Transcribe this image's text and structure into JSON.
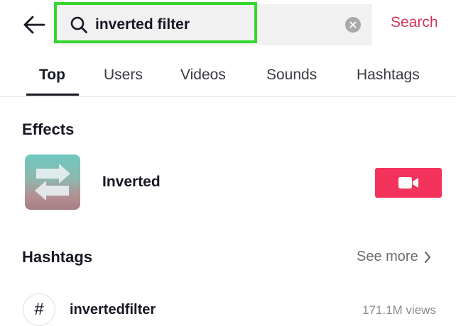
{
  "search": {
    "value": "inverted filter",
    "button_label": "Search"
  },
  "tabs": [
    {
      "label": "Top",
      "active": true
    },
    {
      "label": "Users"
    },
    {
      "label": "Videos"
    },
    {
      "label": "Sounds"
    },
    {
      "label": "Hashtags"
    }
  ],
  "effects": {
    "title": "Effects",
    "items": [
      {
        "name": "Inverted",
        "icon": "video-camera-icon"
      }
    ]
  },
  "hashtags": {
    "title": "Hashtags",
    "see_more_label": "See more",
    "items": [
      {
        "symbol": "#",
        "name": "invertedfilter",
        "views": "171.1M views"
      }
    ]
  },
  "colors": {
    "accent": "#f3335c",
    "search_button": "#d4375a",
    "highlight": "#35d62e"
  }
}
